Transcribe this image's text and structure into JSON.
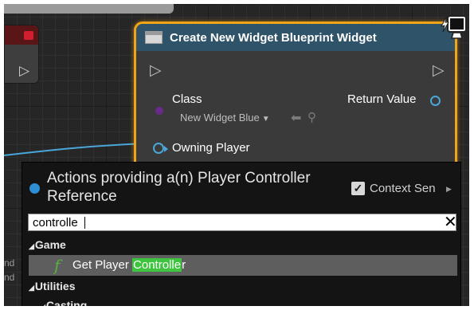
{
  "graph": {
    "left_snippet_lines": [
      "nd",
      "nd"
    ]
  },
  "node": {
    "title": "Create New Widget Blueprint Widget",
    "class_label": "Class",
    "class_value": "New Widget Blue",
    "return_label": "Return Value",
    "owning_label": "Owning Player"
  },
  "menu": {
    "title": "Actions providing a(n) Player Controller Reference",
    "context_label": "Context Sen",
    "context_checked": true,
    "search": {
      "value": "controlle"
    },
    "categories": {
      "game": "Game",
      "utilities": "Utilities",
      "casting": "Casting"
    },
    "result": {
      "prefix": "Get Player ",
      "highlight": "Controlle",
      "suffix": "r"
    }
  },
  "colors": {
    "node_border": "#f0a418",
    "node_header": "#2f5368",
    "pin_object": "#4aa6d8",
    "highlight": "#3ec43e",
    "function_icon": "#57b040"
  },
  "icons": [
    "widget-icon",
    "exec-pin-icon",
    "monitor-icon",
    "close-icon",
    "function-icon",
    "checkbox-icon",
    "expand-arrow-icon"
  ]
}
